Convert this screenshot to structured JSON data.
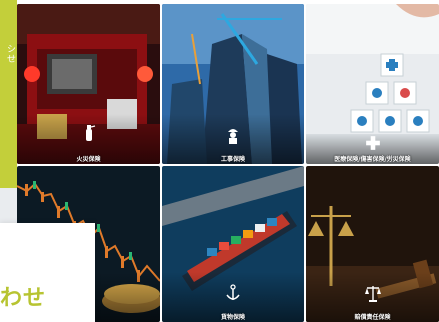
{
  "side": {
    "notice_text": "シ せ"
  },
  "notice": {
    "title": "わせ"
  },
  "tiles": [
    {
      "label": "火災保険",
      "icon": "fire-extinguisher-icon"
    },
    {
      "label": "工事保険",
      "icon": "construction-worker-icon"
    },
    {
      "label": "医療保険/傷害保険/労災保険",
      "icon": "medical-icon"
    },
    {
      "label": "",
      "icon": "chart-icon"
    },
    {
      "label": "貨物保険",
      "icon": "anchor-icon"
    },
    {
      "label": "賠償責任保険",
      "icon": "scales-icon"
    }
  ],
  "colors": {
    "accent": "#b7c431",
    "panel": "#c3cf3a"
  }
}
